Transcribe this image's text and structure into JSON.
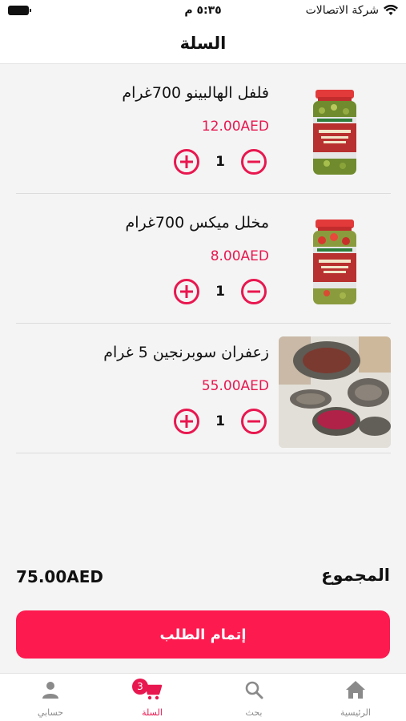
{
  "status_bar": {
    "carrier": "شركة الاتصالات",
    "time": "٥:٣٥ م"
  },
  "header": {
    "title": "السلة"
  },
  "cart": {
    "items": [
      {
        "name": "فلفل الهالبينو 700غرام",
        "price": "12.00AED",
        "quantity": "1"
      },
      {
        "name": "مخلل ميكس 700غرام",
        "price": "8.00AED",
        "quantity": "1"
      },
      {
        "name": "زعفران سوبرنجين 5 غرام",
        "price": "55.00AED",
        "quantity": "1"
      }
    ]
  },
  "summary": {
    "total_label": "المجموع",
    "total_value": "75.00AED",
    "checkout_label": "إتمام الطلب"
  },
  "tab_bar": {
    "tabs": [
      {
        "label": "الرئيسية",
        "icon": "home-icon"
      },
      {
        "label": "بحث",
        "icon": "search-icon"
      },
      {
        "label": "السلة",
        "icon": "cart-icon",
        "badge": "3"
      },
      {
        "label": "حسابي",
        "icon": "user-icon"
      }
    ]
  },
  "colors": {
    "accent": "#e8174f",
    "checkout_button": "#fd1a4f",
    "inactive_tab": "#8a8a8a"
  }
}
